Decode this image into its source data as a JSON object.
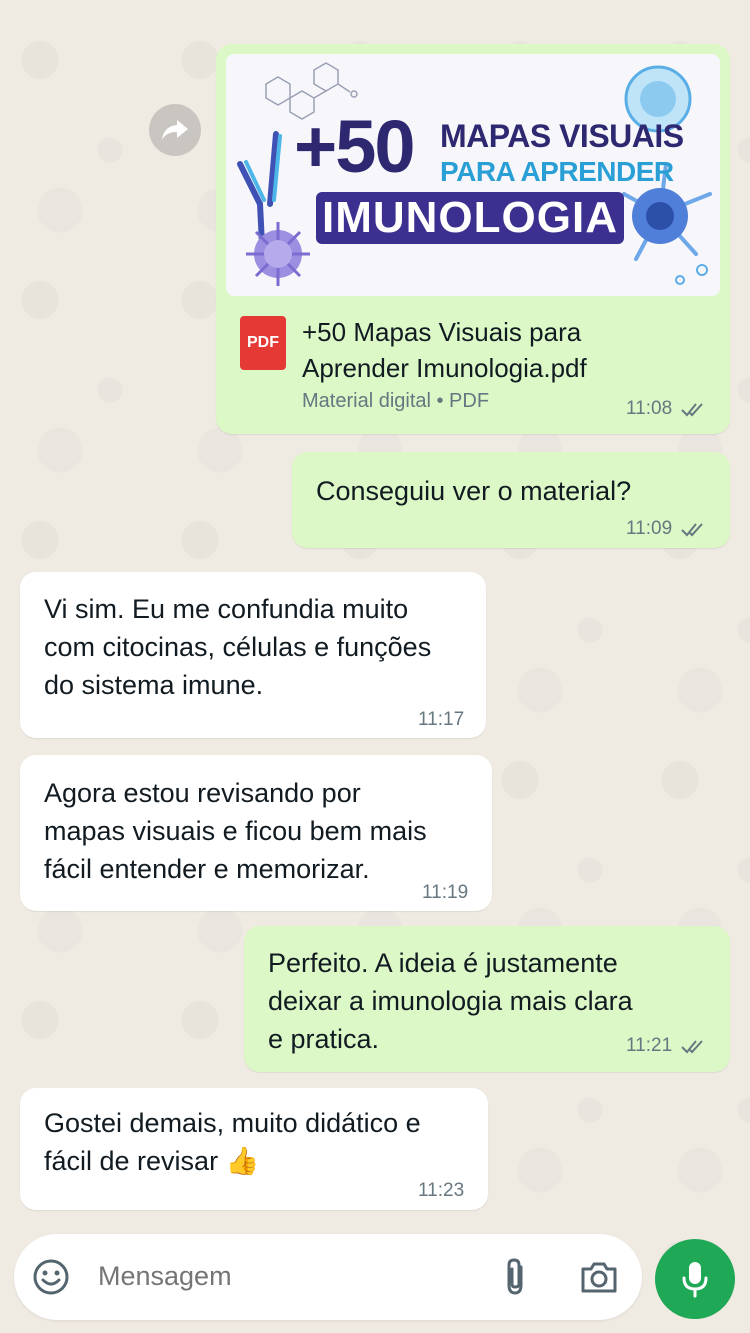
{
  "pdf_message": {
    "banner": {
      "plus": "+50",
      "line1": "MAPAS VISUAIS",
      "line2": "PARA APRENDER",
      "line3": "IMUNOLOGIA"
    },
    "file_badge": "PDF",
    "file_name": "+50 Mapas Visuais para Aprender Imunologia.pdf",
    "file_meta": "Material digital • PDF",
    "time": "11:08"
  },
  "messages": [
    {
      "id": "m1",
      "direction": "out",
      "text": "Conseguiu ver o material?",
      "time": "11:09"
    },
    {
      "id": "m2",
      "direction": "in",
      "text": "Vi sim. Eu me confundia muito\ncom citocinas, células e funções\ndo sistema imune.",
      "time": "11:17"
    },
    {
      "id": "m3",
      "direction": "in",
      "text": "Agora estou revisando por\nmapas visuais e ficou bem mais\nfácil entender e memorizar.",
      "time": "11:19"
    },
    {
      "id": "m4",
      "direction": "out",
      "text": "Perfeito.  A ideia é justamente\ndeixar a imunologia mais clara\ne pratica.",
      "time": "11:21"
    },
    {
      "id": "m5",
      "direction": "in",
      "text": "Gostei demais, muito didático e\nfácil de revisar 👍",
      "time": "11:23"
    }
  ],
  "composer": {
    "placeholder": "Mensagem"
  },
  "icons": {
    "forward": "forward-icon",
    "emoji": "emoji-icon",
    "attach": "paperclip-icon",
    "camera": "camera-icon",
    "mic": "microphone-icon",
    "read": "double-check-icon"
  },
  "colors": {
    "background": "#efeae2",
    "outgoing_bubble": "#dcf8c6",
    "incoming_bubble": "#ffffff",
    "read_ticks": "#667781",
    "mic_button": "#1fa855",
    "pdf_icon": "#e53935"
  }
}
